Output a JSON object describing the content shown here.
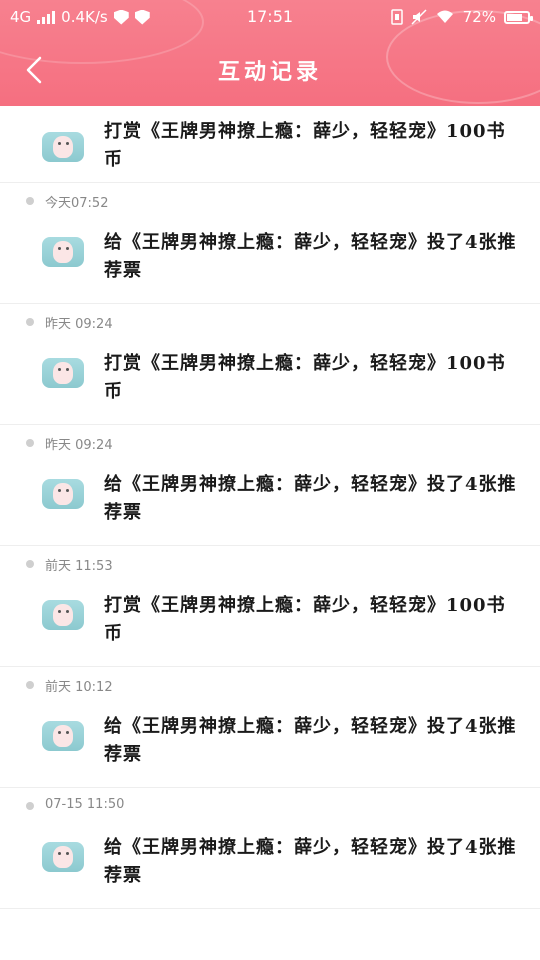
{
  "status": {
    "network": "4G",
    "speed": "0.4K/s",
    "time": "17:51",
    "battery": "72%"
  },
  "nav": {
    "title": "互动记录"
  },
  "records": [
    {
      "time": "",
      "text": "打赏《王牌男神撩上瘾：薛少，轻轻宠》100书币"
    },
    {
      "time": "今天07:52",
      "text": "给《王牌男神撩上瘾：薛少，轻轻宠》投了4张推荐票"
    },
    {
      "time": "昨天 09:24",
      "text": "打赏《王牌男神撩上瘾：薛少，轻轻宠》100书币"
    },
    {
      "time": "昨天 09:24",
      "text": "给《王牌男神撩上瘾：薛少，轻轻宠》投了4张推荐票"
    },
    {
      "time": "前天 11:53",
      "text": "打赏《王牌男神撩上瘾：薛少，轻轻宠》100书币"
    },
    {
      "time": "前天 10:12",
      "text": "给《王牌男神撩上瘾：薛少，轻轻宠》投了4张推荐票"
    },
    {
      "time": "07-15 11:50",
      "text": "给《王牌男神撩上瘾：薛少，轻轻宠》投了4张推荐票"
    }
  ],
  "icons": {
    "back": "chevron-left-icon",
    "signal": "signal-icon",
    "wifi": "wifi-icon",
    "battery": "battery-icon"
  },
  "colors": {
    "header": "#f7818f",
    "text": "#1a1a1a",
    "time": "#888888"
  }
}
